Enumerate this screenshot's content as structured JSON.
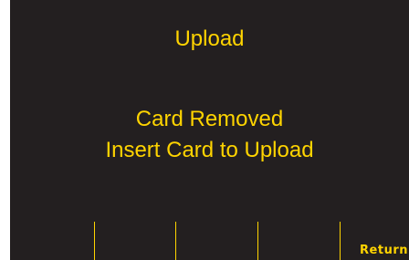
{
  "screen": {
    "title": "Upload",
    "message_line1": "Card Removed",
    "message_line2": "Insert Card to Upload",
    "colors": {
      "background": "#231f20",
      "text": "#ffd400"
    }
  },
  "softkeys": [
    {
      "label": ""
    },
    {
      "label": ""
    },
    {
      "label": ""
    },
    {
      "label": "Return"
    }
  ]
}
